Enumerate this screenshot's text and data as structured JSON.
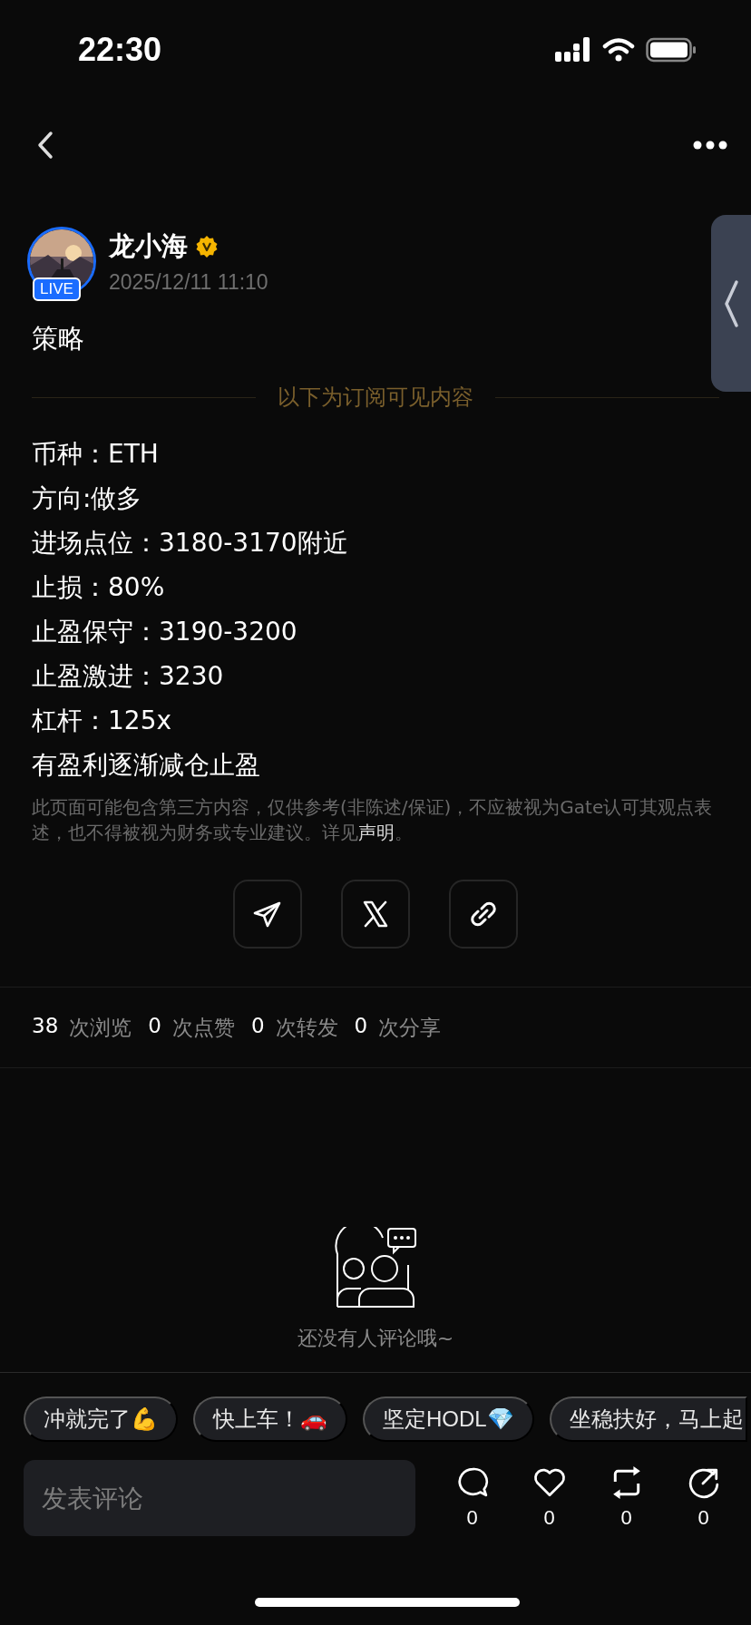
{
  "status_bar": {
    "time": "22:30"
  },
  "author": {
    "name": "龙小海",
    "verified": true,
    "live_badge": "LIVE",
    "date": "2025/12/11 11:10"
  },
  "post": {
    "title": "策略",
    "divider_label": "以下为订阅可见内容",
    "lines": [
      "币种：ETH",
      "方向:做多",
      "进场点位：3180-3170附近",
      "止损：80%",
      "止盈保守：3190-3200",
      "止盈激进：3230",
      "杠杆：125x",
      "有盈利逐渐减仓止盈"
    ],
    "disclaimer": {
      "text": "此页面可能包含第三方内容，仅供参考(非陈述/保证)，不应被视为Gate认可其观点表述，也不得被视为财务或专业建议。详见",
      "link": "声明",
      "end": "。"
    }
  },
  "share_buttons": [
    {
      "kind": "telegram"
    },
    {
      "kind": "x"
    },
    {
      "kind": "link"
    }
  ],
  "stats": [
    {
      "count": "38",
      "label": "次浏览"
    },
    {
      "count": "0",
      "label": "次点赞"
    },
    {
      "count": "0",
      "label": "次转发"
    },
    {
      "count": "0",
      "label": "次分享"
    }
  ],
  "empty_comments": {
    "text": "还没有人评论哦~"
  },
  "quick_replies": [
    "冲就完了💪",
    "快上车！🚗",
    "坚定HODL💎",
    "坐稳扶好，马上起"
  ],
  "comment_input": {
    "placeholder": "发表评论"
  },
  "actions": [
    {
      "kind": "comment",
      "count": "0"
    },
    {
      "kind": "like",
      "count": "0"
    },
    {
      "kind": "repost",
      "count": "0"
    },
    {
      "kind": "share",
      "count": "0"
    }
  ]
}
